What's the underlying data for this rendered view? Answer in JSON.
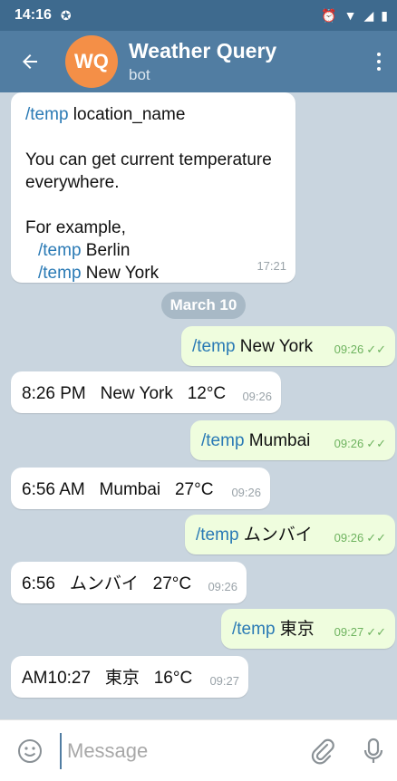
{
  "status_bar": {
    "time": "14:16"
  },
  "header": {
    "title": "Weather Query",
    "subtitle": "bot",
    "avatar_initials": "WQ",
    "avatar_color": "#f48f47"
  },
  "date_separator": "March 10",
  "messages": [
    {
      "direction": "in",
      "lines": [
        {
          "cmd": "/temp",
          "text": " location_name"
        },
        {
          "text": ""
        },
        {
          "text": "You can get current temperature"
        },
        {
          "text": "everywhere."
        },
        {
          "text": ""
        },
        {
          "text": "For example,"
        },
        {
          "cmd": "/temp",
          "text": " Berlin",
          "indent": true
        },
        {
          "cmd": "/temp",
          "text": " New York",
          "indent": true
        }
      ],
      "time": "17:21"
    },
    {
      "direction": "out",
      "cmd": "/temp",
      "text": " New York",
      "time": "09:26"
    },
    {
      "direction": "in",
      "text": "8:26 PM   New York   12°C",
      "time": "09:26"
    },
    {
      "direction": "out",
      "cmd": "/temp",
      "text": " Mumbai",
      "time": "09:26"
    },
    {
      "direction": "in",
      "text": "6:56 AM   Mumbai   27°C",
      "time": "09:26"
    },
    {
      "direction": "out",
      "cmd": "/temp",
      "text": " ムンバイ",
      "time": "09:26"
    },
    {
      "direction": "in",
      "text": "6:56   ムンバイ   27°C",
      "time": "09:26"
    },
    {
      "direction": "out",
      "cmd": "/temp",
      "text": " 東京",
      "time": "09:27"
    },
    {
      "direction": "in",
      "text": "AM10:27   東京   16°C",
      "time": "09:27"
    }
  ],
  "input": {
    "placeholder": "Message"
  },
  "colors": {
    "header": "#517da2",
    "status_bar": "#3e6a8e",
    "outgoing_bubble": "#effdde",
    "command": "#2a7ab5"
  }
}
